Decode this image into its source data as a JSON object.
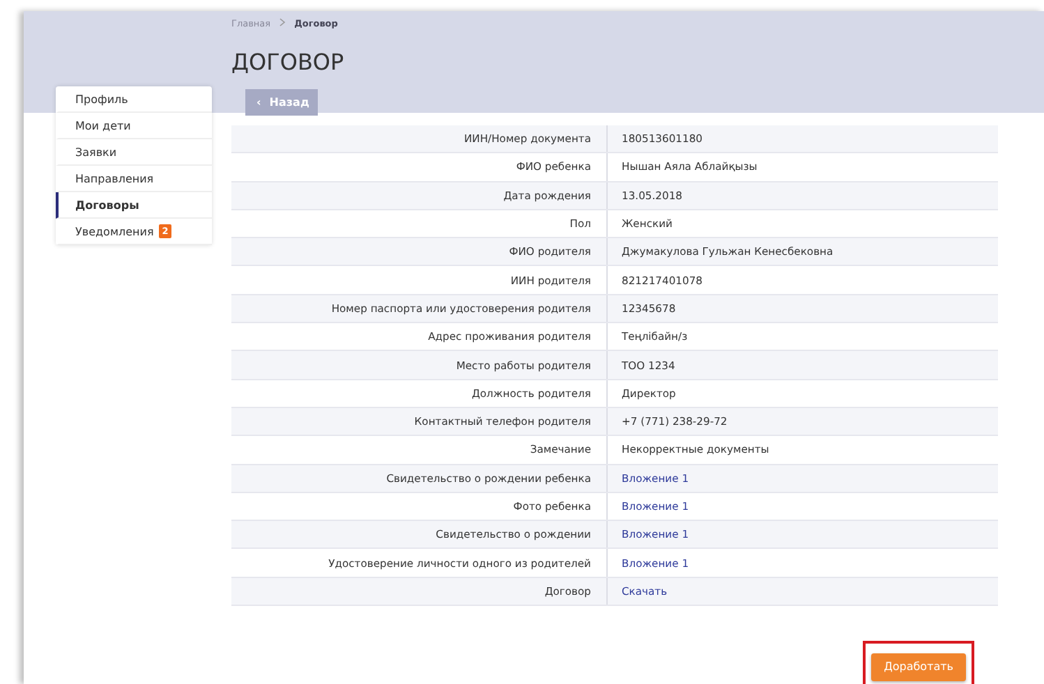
{
  "breadcrumb": [
    "Главная",
    "Договор"
  ],
  "title": "ДОГОВОР",
  "back_button": {
    "icon": "‹",
    "label": "Назад"
  },
  "sidebar": {
    "items": [
      {
        "label": "Профиль",
        "selected": false
      },
      {
        "label": "Мои дети",
        "selected": false
      },
      {
        "label": "Заявки",
        "selected": false
      },
      {
        "label": "Направления",
        "selected": false
      },
      {
        "label": "Договоры",
        "selected": true
      },
      {
        "label": "Уведомления",
        "selected": false,
        "badge": "2"
      }
    ]
  },
  "table": {
    "rows": [
      {
        "label": "ИИН/Номер документа",
        "value": "180513601180",
        "kind": "text"
      },
      {
        "label": "ФИО ребенка",
        "value": "Нышан Аяла Аблайқызы",
        "kind": "text"
      },
      {
        "label": "Дата рождения",
        "value": "13.05.2018",
        "kind": "text"
      },
      {
        "label": "Пол",
        "value": "Женский",
        "kind": "text"
      },
      {
        "label": "ФИО родителя",
        "value": "Джумакулова Гульжан Кенесбековна",
        "kind": "text"
      },
      {
        "label": "ИИН родителя",
        "value": "821217401078",
        "kind": "text"
      },
      {
        "label": "Номер паспорта или удостоверения родителя",
        "value": "12345678",
        "kind": "text"
      },
      {
        "label": "Адрес проживания родителя",
        "value": "Теңлібайн/з",
        "kind": "text"
      },
      {
        "label": "Место работы родителя",
        "value": "ТОО 1234",
        "kind": "text"
      },
      {
        "label": "Должность родителя",
        "value": "Директор",
        "kind": "text"
      },
      {
        "label": "Контактный телефон родителя",
        "value": "+7 (771) 238-29-72",
        "kind": "text"
      },
      {
        "label": "Замечание",
        "value": "Некорректные документы",
        "kind": "text"
      },
      {
        "label": "Свидетельство о рождении ребенка",
        "value": "Вложение 1",
        "kind": "link"
      },
      {
        "label": "Фото ребенка",
        "value": "Вложение 1",
        "kind": "link"
      },
      {
        "label": "Свидетельство о рождении",
        "value": "Вложение 1",
        "kind": "link"
      },
      {
        "label": "Удостоверение личности одного из родителей",
        "value": "Вложение 1",
        "kind": "link"
      },
      {
        "label": "Договор",
        "value": "Скачать",
        "kind": "link"
      }
    ]
  },
  "action_button": {
    "label": "Доработать",
    "highlighted": true
  }
}
